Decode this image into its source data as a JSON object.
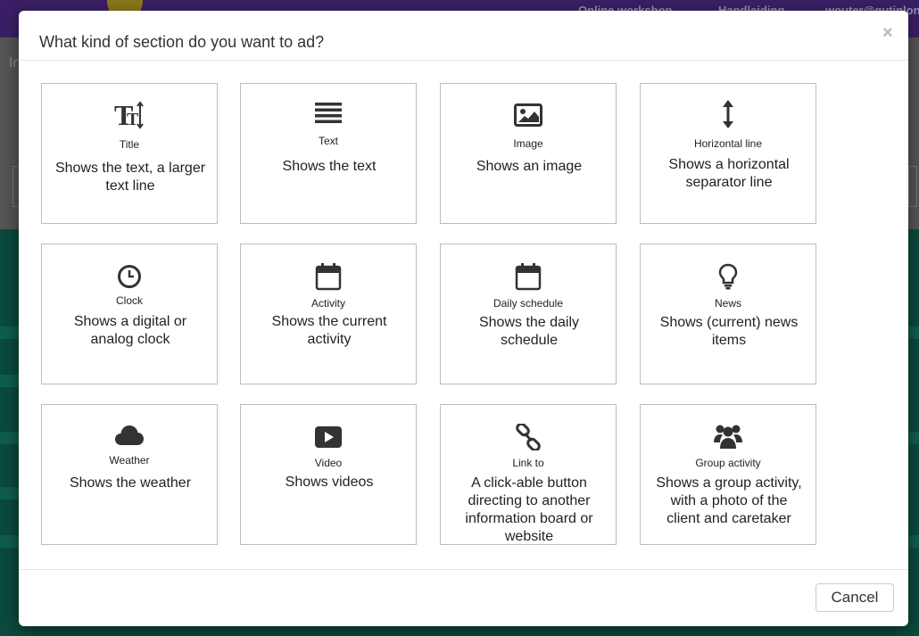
{
  "background": {
    "topbar_links": [
      "Online workshop",
      "Handleiding",
      "wouter@gutinlon"
    ],
    "side_letter": "In"
  },
  "modal": {
    "title": "What kind of section do you want to ad?",
    "close_symbol": "×",
    "cancel_label": "Cancel"
  },
  "sections": [
    {
      "name": "Title",
      "description": "Shows the text, a larger text line",
      "icon": "title-text-icon"
    },
    {
      "name": "Text",
      "description": "Shows the text",
      "icon": "text-lines-icon"
    },
    {
      "name": "Image",
      "description": "Shows an image",
      "icon": "image-icon"
    },
    {
      "name": "Horizontal line",
      "description": "Shows a horizontal separator line",
      "icon": "vertical-arrows-icon"
    },
    {
      "name": "Clock",
      "description": "Shows a digital or analog clock",
      "icon": "clock-icon"
    },
    {
      "name": "Activity",
      "description": "Shows the current activity",
      "icon": "calendar-icon"
    },
    {
      "name": "Daily schedule",
      "description": "Shows the daily schedule",
      "icon": "calendar-icon"
    },
    {
      "name": "News",
      "description": "Shows (current) news items",
      "icon": "lightbulb-icon"
    },
    {
      "name": "Weather",
      "description": "Shows the weather",
      "icon": "cloud-icon"
    },
    {
      "name": "Video",
      "description": "Shows videos",
      "icon": "video-play-icon"
    },
    {
      "name": "Link to",
      "description": "A click-able button directing to another information board or website",
      "icon": "link-icon"
    },
    {
      "name": "Group activity",
      "description": "Shows a group activity, with a photo of the client and caretaker",
      "icon": "group-icon"
    }
  ]
}
